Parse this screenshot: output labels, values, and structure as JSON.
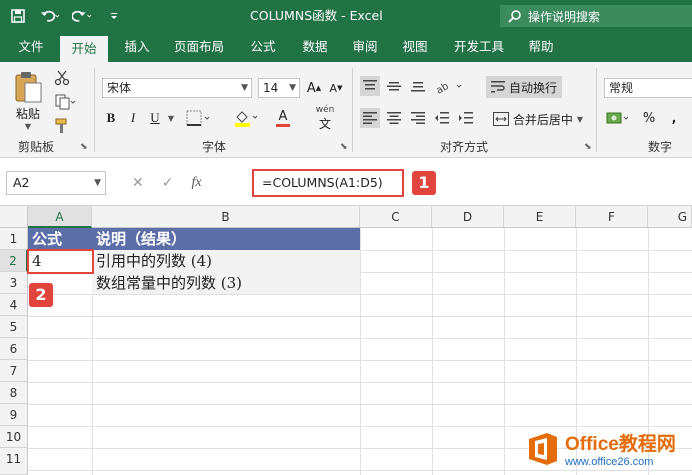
{
  "title_bar": {
    "window_title": "COLUMNS函数 - Excel",
    "tell_me": "操作说明搜索"
  },
  "tabs": [
    "文件",
    "开始",
    "插入",
    "页面布局",
    "公式",
    "数据",
    "审阅",
    "视图",
    "开发工具",
    "帮助"
  ],
  "active_tab": "开始",
  "ribbon": {
    "clipboard": {
      "paste_label": "粘贴",
      "group_label": "剪贴板"
    },
    "font": {
      "font_name": "宋体",
      "font_size": "14",
      "group_label": "字体",
      "bold": "B",
      "italic": "I",
      "underline": "U",
      "font_color_glyph": "A",
      "phonetic": "wén"
    },
    "alignment": {
      "wrap_text": "自动换行",
      "merge_center": "合并后居中",
      "group_label": "对齐方式"
    },
    "number": {
      "format": "常规",
      "percent": "%",
      "group_label": "数字"
    }
  },
  "formula_bar": {
    "name_box": "A2",
    "formula": "=COLUMNS(A1:D5)",
    "fx": "fx",
    "callout_1": "1"
  },
  "sheet": {
    "columns": [
      "A",
      "B",
      "C",
      "D",
      "E",
      "F",
      "G"
    ],
    "rows": [
      "1",
      "2",
      "3",
      "4",
      "5",
      "6",
      "7",
      "8",
      "9",
      "10",
      "11"
    ],
    "selected_column": "A",
    "selected_row": "2",
    "cells": {
      "A1": "公式",
      "B1": "说明（结果）",
      "A2": "4",
      "B2": "引用中的列数 (4)",
      "B3": "数组常量中的列数 (3)"
    },
    "callout_2": "2"
  },
  "watermark": {
    "brand": "Office教程网",
    "url": "www.office26.com"
  },
  "colors": {
    "excel_green": "#217346",
    "header_fill": "#5b6ea8",
    "callout_red": "#e0443c",
    "brand_orange": "#e46c0a"
  }
}
